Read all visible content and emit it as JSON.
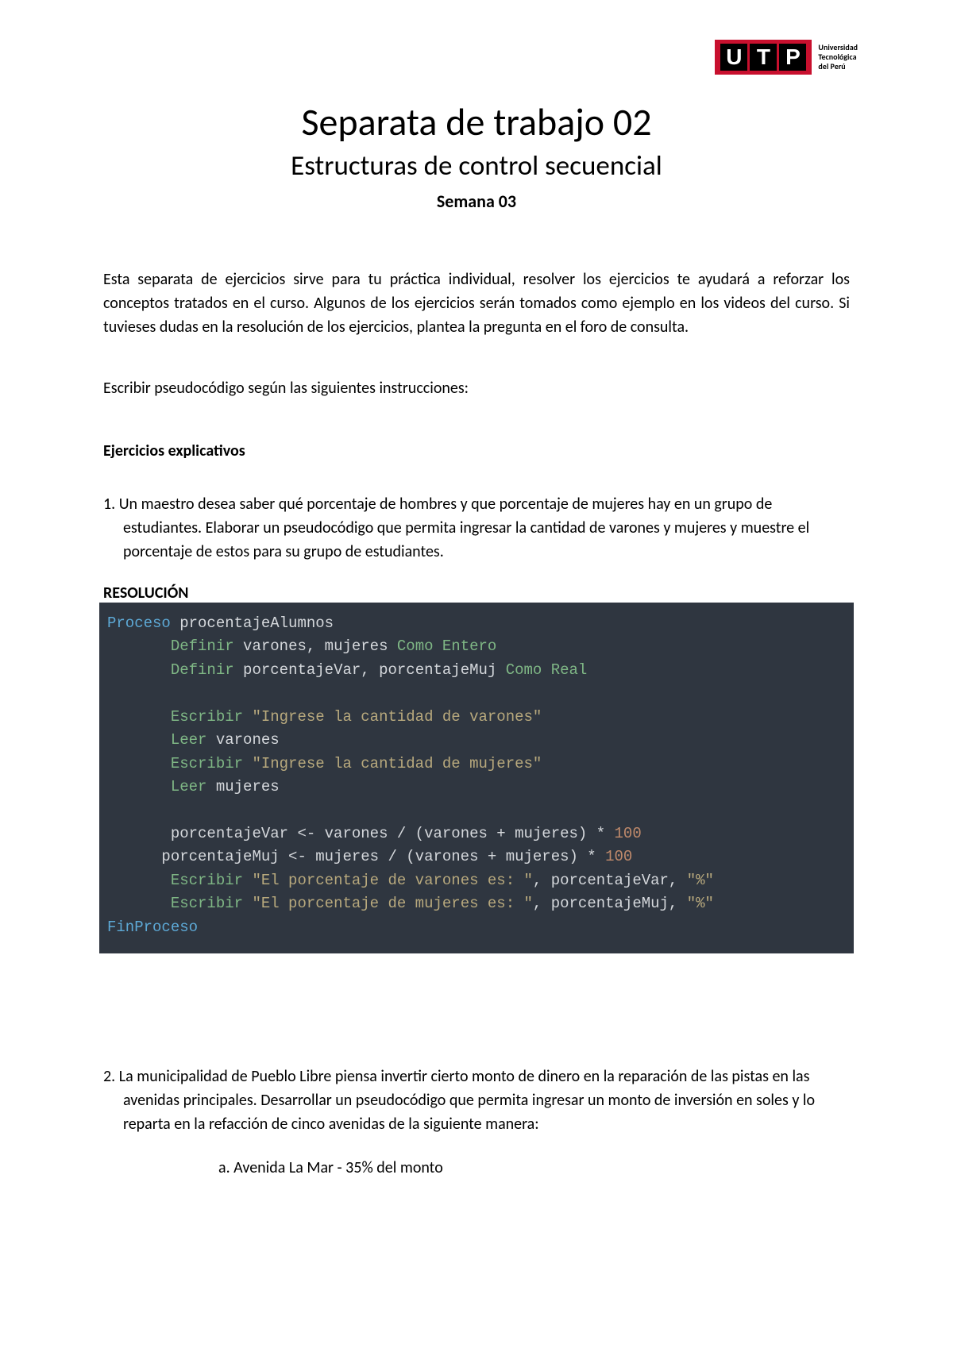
{
  "logo": {
    "letters": [
      "U",
      "T",
      "P"
    ],
    "text_line1": "Universidad",
    "text_line2": "Tecnológica",
    "text_line3": "del Perú"
  },
  "header": {
    "title": "Separata de trabajo 02",
    "subtitle": "Estructuras de control secuencial",
    "week": "Semana 03"
  },
  "intro": "Esta separata de ejercicios sirve para tu práctica individual, resolver los ejercicios te ayudará a reforzar los conceptos tratados en el curso. Algunos de los ejercicios serán tomados como ejemplo en los videos del curso. Si tuvieses dudas en la resolución de los ejercicios, plantea la pregunta en el foro de consulta.",
  "instruction": "Escribir pseudocódigo según las siguientes instrucciones:",
  "section_title": "Ejercicios explicativos",
  "exercise1": {
    "number": "1.",
    "text": "Un maestro desea saber qué porcentaje de hombres y que porcentaje de mujeres hay en un grupo de estudiantes. Elaborar un pseudocódigo que permita ingresar la cantidad de varones y mujeres y muestre el porcentaje de estos para su grupo de estudiantes."
  },
  "resolution_label": "RESOLUCIÓN",
  "code": {
    "l1_proc": "Proceso",
    "l1_name": " procentajeAlumnos",
    "l2_def": "Definir",
    "l2_vars": " varones, mujeres ",
    "l2_como": "Como Entero",
    "l3_def": "Definir",
    "l3_vars": " porcentajeVar, porcentajeMuj ",
    "l3_como": "Como Real",
    "l5_esc": "Escribir",
    "l5_str": " \"Ingrese la cantidad de varones\"",
    "l6_leer": "Leer",
    "l6_var": " varones",
    "l7_esc": "Escribir",
    "l7_str": " \"Ingrese la cantidad de mujeres\"",
    "l8_leer": "Leer",
    "l8_var": " mujeres",
    "l10_expr": "porcentajeVar <- varones / (varones + mujeres) * ",
    "l10_num": "100",
    "l11_expr": "porcentajeMuj <- mujeres / (varones + mujeres) * ",
    "l11_num": "100",
    "l12_esc": "Escribir",
    "l12_str1": " \"El porcentaje de varones es: \"",
    "l12_mid": ", porcentajeVar, ",
    "l12_str2": "\"%\"",
    "l13_esc": "Escribir",
    "l13_str1": " \"El porcentaje de mujeres es: \"",
    "l13_mid": ", porcentajeMuj, ",
    "l13_str2": "\"%\"",
    "l14_fin": "FinProceso"
  },
  "exercise2": {
    "number": "2.",
    "text": "La municipalidad de Pueblo Libre piensa invertir cierto monto de dinero en la reparación de las pistas en las avenidas principales. Desarrollar un pseudocódigo que permita ingresar un monto de inversión en soles y lo reparta en la refacción de cinco avenidas de la siguiente manera:",
    "sub_a": "a.   Avenida La Mar - 35% del monto"
  }
}
